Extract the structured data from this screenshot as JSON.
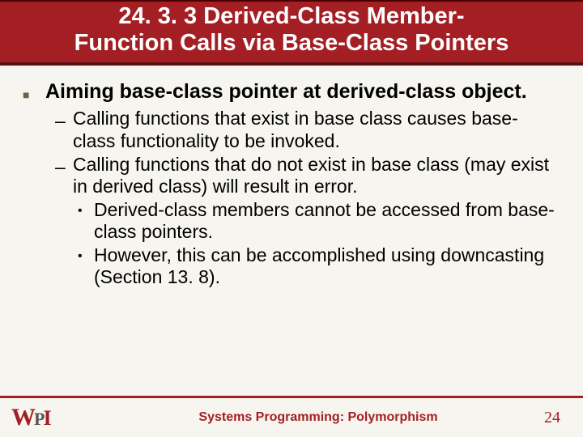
{
  "title_line1": "24. 3. 3 Derived-Class Member-",
  "title_line2": "Function Calls via Base-Class Pointers",
  "bullets": {
    "main": "Aiming base-class pointer at derived-class object.",
    "sub1": "Calling functions that exist in base class causes base-class functionality to be invoked.",
    "sub2": "Calling functions that do not exist in base class (may exist in derived class) will result in error.",
    "subsub1": "Derived-class members cannot be accessed from base-class pointers.",
    "subsub2": "However, this can be accomplished using downcasting (Section 13. 8)."
  },
  "footer": {
    "logo_text": "WPI",
    "course": "Systems Programming:  Polymorphism",
    "page": "24"
  }
}
